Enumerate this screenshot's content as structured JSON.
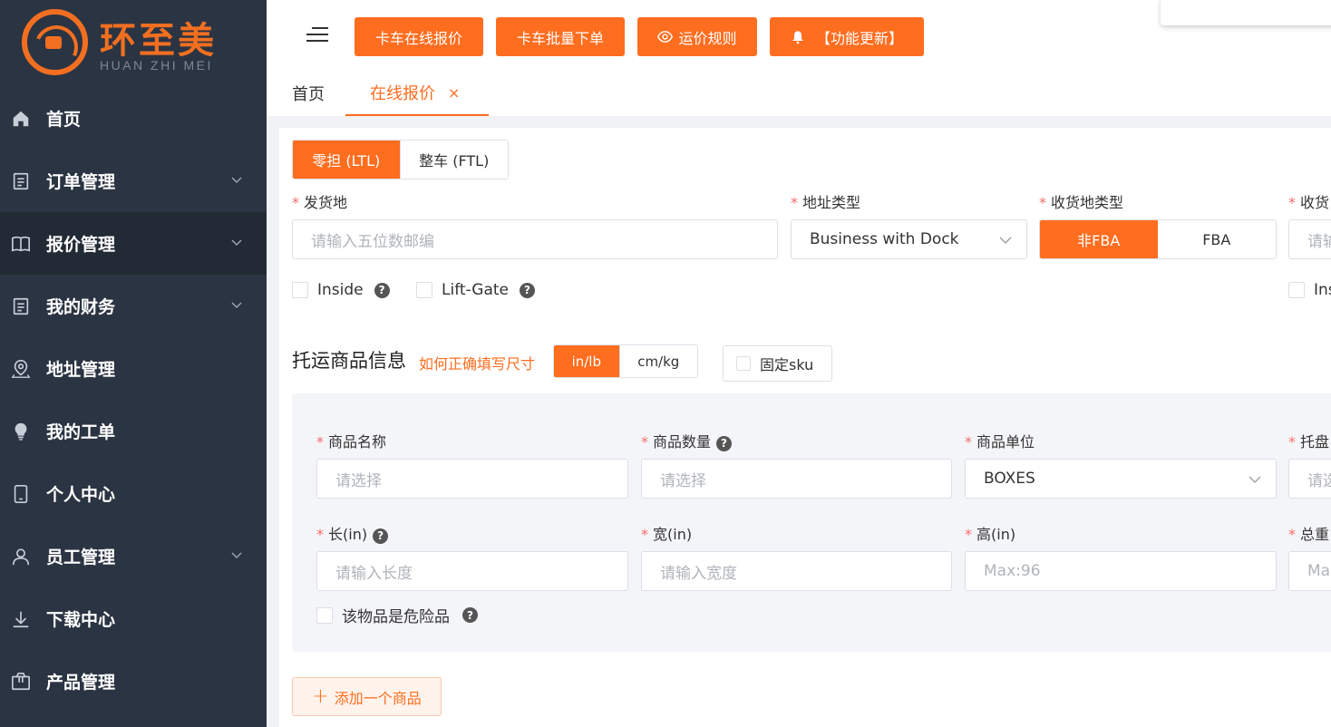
{
  "brand": {
    "name_cn": "环至美",
    "name_en": "HUAN ZHI MEI",
    "accent": "#ff6d1f"
  },
  "sidebar": {
    "items": [
      {
        "label": "首页",
        "icon": "home-icon",
        "has_chevron": false,
        "active": false
      },
      {
        "label": "订单管理",
        "icon": "document-icon",
        "has_chevron": true,
        "active": false
      },
      {
        "label": "报价管理",
        "icon": "book-icon",
        "has_chevron": true,
        "active": true
      },
      {
        "label": "我的财务",
        "icon": "ledger-icon",
        "has_chevron": true,
        "active": false
      },
      {
        "label": "地址管理",
        "icon": "location-icon",
        "has_chevron": false,
        "active": false
      },
      {
        "label": "我的工单",
        "icon": "bulb-icon",
        "has_chevron": false,
        "active": false
      },
      {
        "label": "个人中心",
        "icon": "tablet-icon",
        "has_chevron": false,
        "active": false
      },
      {
        "label": "员工管理",
        "icon": "user-icon",
        "has_chevron": true,
        "active": false
      },
      {
        "label": "下载中心",
        "icon": "download-icon",
        "has_chevron": false,
        "active": false
      },
      {
        "label": "产品管理",
        "icon": "package-icon",
        "has_chevron": false,
        "active": false
      }
    ]
  },
  "toolbar": {
    "truck_quote": "卡车在线报价",
    "truck_batch": "卡车批量下单",
    "freight_rules": "运价规则",
    "feature_update": "【功能更新】"
  },
  "tabs": {
    "home": "首页",
    "online_quote": "在线报价",
    "close": "×"
  },
  "shipping_mode": {
    "ltl": "零担 (LTL)",
    "ftl": "整车 (FTL)",
    "selected": "ltl"
  },
  "form": {
    "origin_label": "发货地",
    "origin_placeholder": "请输入五位数邮编",
    "address_type_label": "地址类型",
    "address_type_value": "Business with Dock",
    "dest_type_label": "收货地类型",
    "dest_type_options": [
      "非FBA",
      "FBA"
    ],
    "dest_type_selected": "非FBA",
    "dest_label_partial": "收货",
    "dest_placeholder_partial": "请输",
    "inside_label": "Inside",
    "liftgate_label": "Lift-Gate",
    "inside_right_partial": "Ins"
  },
  "goods": {
    "section_title": "托运商品信息",
    "howto_link": "如何正确填写尺寸",
    "units": [
      "in/lb",
      "cm/kg"
    ],
    "unit_selected": "in/lb",
    "fixed_sku": "固定sku",
    "name_label": "商品名称",
    "name_placeholder": "请选择",
    "qty_label": "商品数量",
    "qty_placeholder": "请选择",
    "unit_label": "商品单位",
    "unit_value": "BOXES",
    "pallet_label_partial": "托盘",
    "pallet_placeholder_partial": "请选",
    "length_label": "长(in)",
    "length_placeholder": "请输入长度",
    "width_label": "宽(in)",
    "width_placeholder": "请输入宽度",
    "height_label": "高(in)",
    "height_placeholder": "Max:96",
    "weight_label_partial": "总重",
    "weight_placeholder_partial": "Ma",
    "dangerous_label": "该物品是危险品",
    "add_button": "添加一个商品"
  }
}
